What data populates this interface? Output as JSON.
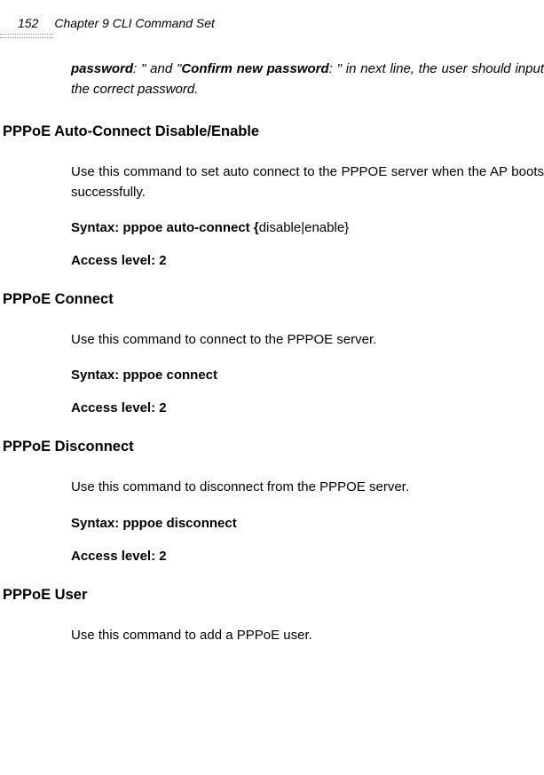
{
  "header": {
    "page_number": "152",
    "chapter": "Chapter 9 CLI Command Set"
  },
  "intro": {
    "part1_bold": "password",
    "part2": ": \" and \"",
    "part3_bold": "Confirm new password",
    "part4": ": \" in next line, the user should input the correct password."
  },
  "sections": [
    {
      "title": "PPPoE Auto-Connect Disable/Enable",
      "description": "Use this command to set auto connect to the PPPOE server when the AP boots successfully.",
      "syntax_label": "Syntax: pppoe auto-connect {",
      "syntax_args": "disable|enable}",
      "access": "Access level: 2"
    },
    {
      "title": "PPPoE Connect",
      "description": "Use this command to connect to the PPPOE server.",
      "syntax_label": "Syntax: pppoe connect",
      "syntax_args": "",
      "access": "Access level: 2"
    },
    {
      "title": "PPPoE Disconnect",
      "description": "Use this command to disconnect from the PPPOE server.",
      "syntax_label": "Syntax: pppoe disconnect",
      "syntax_args": "",
      "access": "Access level: 2"
    },
    {
      "title": "PPPoE User",
      "description": "Use this command to add a PPPoE user.",
      "syntax_label": "",
      "syntax_args": "",
      "access": ""
    }
  ]
}
